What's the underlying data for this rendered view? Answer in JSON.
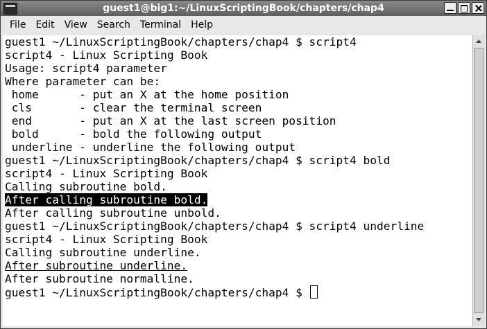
{
  "window": {
    "title": "guest1@big1:~/LinuxScriptingBook/chapters/chap4"
  },
  "menu": {
    "items": [
      "File",
      "Edit",
      "View",
      "Search",
      "Terminal",
      "Help"
    ]
  },
  "terminal": {
    "prompt": "guest1 ~/LinuxScriptingBook/chapters/chap4 $ ",
    "lines": [
      "guest1 ~/LinuxScriptingBook/chapters/chap4 $ script4",
      "script4 - Linux Scripting Book",
      "Usage: script4 parameter",
      "Where parameter can be:",
      " home      - put an X at the home position",
      " cls       - clear the terminal screen",
      " end       - put an X at the last screen position",
      " bold      - bold the following output",
      " underline - underline the following output",
      "guest1 ~/LinuxScriptingBook/chapters/chap4 $ script4 bold",
      "script4 - Linux Scripting Book",
      "Calling subroutine bold.",
      "After calling subroutine bold.",
      "After calling subroutine unbold.",
      "guest1 ~/LinuxScriptingBook/chapters/chap4 $ script4 underline",
      "script4 - Linux Scripting Book",
      "Calling subroutine underline.",
      "After subroutine underline.",
      "After subroutine normalline."
    ]
  }
}
